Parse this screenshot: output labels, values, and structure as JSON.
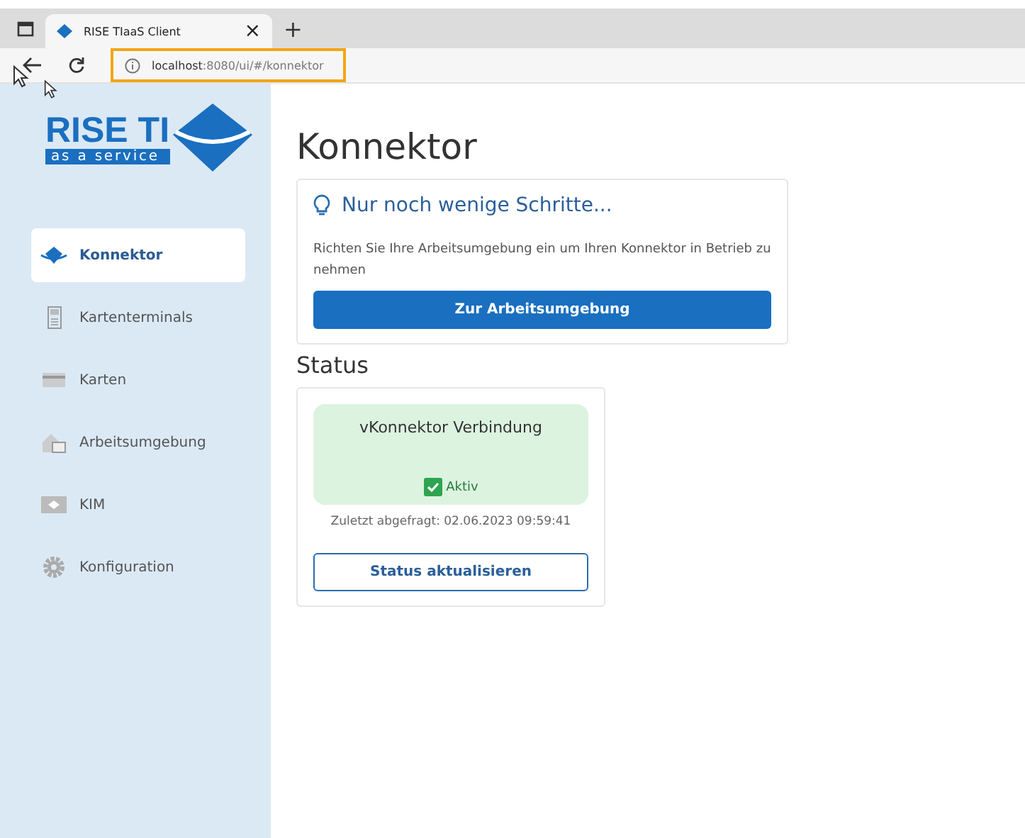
{
  "browser": {
    "tab_title": "RISE TIaaS Client",
    "close": "×",
    "new_tab": "+",
    "url_host": "localhost",
    "url_path": ":8080/ui/#/konnektor",
    "url_highlighted": true
  },
  "logo": {
    "title": "RISE TI",
    "subtitle": "as a service"
  },
  "sidebar": {
    "items": [
      {
        "label": "Konnektor",
        "kind": "konnektor",
        "selected": true
      },
      {
        "label": "Kartenterminals",
        "kind": "terminal",
        "selected": false
      },
      {
        "label": "Karten",
        "kind": "card",
        "selected": false
      },
      {
        "label": "Arbeitsumgebung",
        "kind": "workspace",
        "selected": false
      },
      {
        "label": "KIM",
        "kind": "kim",
        "selected": false
      },
      {
        "label": "Konfiguration",
        "kind": "gear",
        "selected": false
      }
    ]
  },
  "page_title": "Konnektor",
  "hint_card": {
    "title": "Nur noch wenige Schritte...",
    "text": "Richten Sie Ihre Arbeitsumgebung ein um Ihren Konnektor in Betrieb zu nehmen",
    "button": "Zur Arbeitsumgebung"
  },
  "status": {
    "heading": "Status",
    "card_title": "vKonnektor Verbindung",
    "active": true,
    "state_label": "Aktiv",
    "last_checked": "Zuletzt abgefragt: 02.06.2023 09:59:41",
    "button": "Status aktualisieren"
  }
}
